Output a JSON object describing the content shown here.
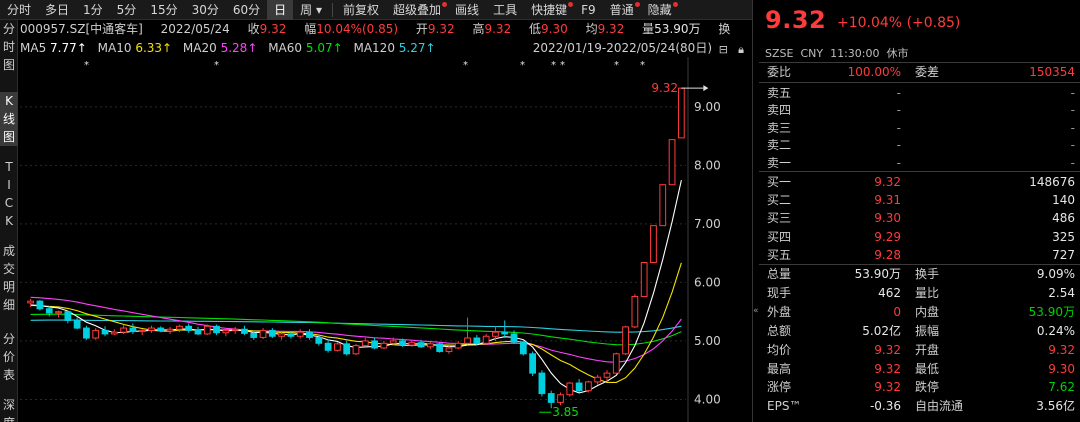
{
  "toolbar": {
    "items": [
      "分时",
      "多日",
      "1分",
      "5分",
      "15分",
      "30分",
      "60分",
      "日",
      "周",
      "前复权",
      "超级叠加",
      "画线",
      "工具",
      "快捷键",
      "F9",
      "普通",
      "隐藏"
    ],
    "active": "日"
  },
  "vtabs": [
    "分时图",
    "K线图",
    "TICK",
    "成交明细",
    "分价表",
    "深度"
  ],
  "info": {
    "code": "000957.SZ[中通客车]",
    "date": "2022/05/24",
    "close_label": "收",
    "close": "9.32",
    "amp_label": "幅",
    "amp": "10.04%(0.85)",
    "open_label": "开",
    "open": "9.32",
    "high_label": "高",
    "high": "9.32",
    "low_label": "低",
    "low": "9.30",
    "avg_label": "均",
    "avg": "9.32",
    "vol_label": "量",
    "vol": "53.90万",
    "turn_label": "换"
  },
  "ma": {
    "ma5_label": "MA5",
    "ma5": "7.77↑",
    "ma10_label": "MA10",
    "ma10": "6.33↑",
    "ma20_label": "MA20",
    "ma20": "5.28↑",
    "ma60_label": "MA60",
    "ma60": "5.07↑",
    "ma120_label": "MA120",
    "ma120": "5.27↑",
    "range": "2022/01/19-2022/05/24(80日)"
  },
  "colors": {
    "up": "#ff3b3b",
    "down": "#00cfe0",
    "ma5": "#ffffff",
    "ma10": "#f2e200",
    "ma20": "#ff40ff",
    "ma60": "#00e000",
    "ma120": "#2ad0e0"
  },
  "chart_data": {
    "type": "candlestick",
    "ylim": [
      3.7,
      9.75
    ],
    "yticks": [
      "9.00",
      "8.00",
      "7.00",
      "6.00",
      "5.00",
      "4.00"
    ],
    "ytick_values": [
      9,
      8,
      7,
      6,
      5,
      4
    ],
    "max_label": "9.32",
    "min_label": "3.85",
    "candles": [
      [
        5.65,
        5.72,
        5.58,
        5.68
      ],
      [
        5.68,
        5.7,
        5.52,
        5.55
      ],
      [
        5.55,
        5.6,
        5.42,
        5.48
      ],
      [
        5.48,
        5.52,
        5.4,
        5.5
      ],
      [
        5.5,
        5.52,
        5.3,
        5.35
      ],
      [
        5.35,
        5.4,
        5.2,
        5.22
      ],
      [
        5.22,
        5.26,
        5.02,
        5.05
      ],
      [
        5.05,
        5.22,
        5.02,
        5.18
      ],
      [
        5.18,
        5.25,
        5.08,
        5.12
      ],
      [
        5.12,
        5.2,
        5.1,
        5.15
      ],
      [
        5.15,
        5.28,
        5.12,
        5.22
      ],
      [
        5.22,
        5.3,
        5.12,
        5.16
      ],
      [
        5.16,
        5.2,
        5.1,
        5.18
      ],
      [
        5.18,
        5.26,
        5.14,
        5.22
      ],
      [
        5.22,
        5.25,
        5.15,
        5.17
      ],
      [
        5.17,
        5.24,
        5.12,
        5.2
      ],
      [
        5.2,
        5.28,
        5.15,
        5.25
      ],
      [
        5.25,
        5.3,
        5.14,
        5.18
      ],
      [
        5.18,
        5.24,
        5.1,
        5.12
      ],
      [
        5.12,
        5.28,
        5.1,
        5.25
      ],
      [
        5.25,
        5.28,
        5.1,
        5.14
      ],
      [
        5.14,
        5.22,
        5.08,
        5.18
      ],
      [
        5.18,
        5.24,
        5.12,
        5.2
      ],
      [
        5.2,
        5.26,
        5.1,
        5.13
      ],
      [
        5.13,
        5.18,
        5.02,
        5.06
      ],
      [
        5.06,
        5.22,
        5.03,
        5.18
      ],
      [
        5.18,
        5.22,
        5.05,
        5.08
      ],
      [
        5.08,
        5.15,
        5.02,
        5.12
      ],
      [
        5.12,
        5.16,
        5.04,
        5.08
      ],
      [
        5.08,
        5.2,
        5.04,
        5.15
      ],
      [
        5.15,
        5.2,
        5.02,
        5.06
      ],
      [
        5.06,
        5.1,
        4.92,
        4.96
      ],
      [
        4.96,
        5.02,
        4.8,
        4.84
      ],
      [
        4.84,
        4.98,
        4.82,
        4.95
      ],
      [
        4.95,
        5.0,
        4.75,
        4.78
      ],
      [
        4.78,
        4.95,
        4.76,
        4.92
      ],
      [
        4.92,
        5.05,
        4.9,
        5.0
      ],
      [
        5.0,
        5.06,
        4.86,
        4.88
      ],
      [
        4.88,
        5.0,
        4.86,
        4.96
      ],
      [
        4.96,
        5.06,
        4.92,
        5.0
      ],
      [
        5.0,
        5.04,
        4.9,
        4.93
      ],
      [
        4.93,
        5.0,
        4.9,
        4.97
      ],
      [
        4.97,
        5.02,
        4.88,
        4.9
      ],
      [
        4.9,
        4.98,
        4.86,
        4.95
      ],
      [
        4.95,
        4.98,
        4.8,
        4.82
      ],
      [
        4.82,
        4.92,
        4.78,
        4.88
      ],
      [
        4.88,
        5.0,
        4.86,
        4.96
      ],
      [
        4.96,
        5.4,
        4.94,
        5.05
      ],
      [
        5.05,
        5.1,
        4.92,
        4.96
      ],
      [
        4.96,
        5.12,
        4.94,
        5.08
      ],
      [
        5.08,
        5.25,
        5.0,
        5.15
      ],
      [
        5.15,
        5.35,
        5.05,
        5.12
      ],
      [
        5.12,
        5.18,
        4.95,
        4.98
      ],
      [
        4.98,
        5.02,
        4.75,
        4.78
      ],
      [
        4.78,
        4.82,
        4.4,
        4.45
      ],
      [
        4.45,
        4.5,
        4.05,
        4.1
      ],
      [
        4.1,
        4.15,
        3.85,
        3.95
      ],
      [
        3.95,
        4.12,
        3.9,
        4.08
      ],
      [
        4.08,
        4.3,
        4.05,
        4.28
      ],
      [
        4.28,
        4.35,
        4.12,
        4.15
      ],
      [
        4.15,
        4.32,
        4.12,
        4.3
      ],
      [
        4.3,
        4.42,
        4.25,
        4.38
      ],
      [
        4.38,
        4.5,
        4.3,
        4.45
      ],
      [
        4.45,
        4.8,
        4.43,
        4.78
      ],
      [
        4.78,
        5.26,
        4.76,
        5.24
      ],
      [
        5.24,
        5.8,
        5.22,
        5.76
      ],
      [
        5.76,
        6.34,
        5.76,
        6.34
      ],
      [
        6.34,
        6.97,
        6.34,
        6.97
      ],
      [
        6.97,
        7.67,
        6.97,
        7.67
      ],
      [
        7.67,
        8.44,
        7.67,
        8.44
      ],
      [
        8.47,
        9.32,
        8.47,
        9.32
      ]
    ]
  },
  "quote": {
    "price": "9.32",
    "change": "+10.04% (+0.85)",
    "market": "SZSE",
    "currency": "CNY",
    "time": "11:30:00",
    "status": "休市",
    "weibi_label": "委比",
    "weibi": "100.00%",
    "weicha_label": "委差",
    "weicha": "150354",
    "asks": [
      {
        "label": "卖五",
        "price": "-",
        "vol": "-"
      },
      {
        "label": "卖四",
        "price": "-",
        "vol": "-"
      },
      {
        "label": "卖三",
        "price": "-",
        "vol": "-"
      },
      {
        "label": "卖二",
        "price": "-",
        "vol": "-"
      },
      {
        "label": "卖一",
        "price": "-",
        "vol": "-"
      }
    ],
    "bids": [
      {
        "label": "买一",
        "price": "9.32",
        "vol": "148676"
      },
      {
        "label": "买二",
        "price": "9.31",
        "vol": "140"
      },
      {
        "label": "买三",
        "price": "9.30",
        "vol": "486"
      },
      {
        "label": "买四",
        "price": "9.29",
        "vol": "325"
      },
      {
        "label": "买五",
        "price": "9.28",
        "vol": "727"
      }
    ],
    "stats": [
      {
        "l1": "总量",
        "v1": "53.90万",
        "c1": "wht",
        "l2": "换手",
        "v2": "9.09%",
        "c2": "wht"
      },
      {
        "l1": "现手",
        "v1": "462",
        "c1": "wht",
        "l2": "量比",
        "v2": "2.54",
        "c2": "wht"
      },
      {
        "l1": "外盘",
        "v1": "0",
        "c1": "red",
        "l2": "内盘",
        "v2": "53.90万",
        "c2": "green"
      },
      {
        "l1": "总额",
        "v1": "5.02亿",
        "c1": "wht",
        "l2": "振幅",
        "v2": "0.24%",
        "c2": "wht"
      },
      {
        "l1": "均价",
        "v1": "9.32",
        "c1": "red",
        "l2": "开盘",
        "v2": "9.32",
        "c2": "red"
      },
      {
        "l1": "最高",
        "v1": "9.32",
        "c1": "red",
        "l2": "最低",
        "v2": "9.30",
        "c2": "red"
      },
      {
        "l1": "涨停",
        "v1": "9.32",
        "c1": "red",
        "l2": "跌停",
        "v2": "7.62",
        "c2": "green"
      },
      {
        "l1": "EPS™",
        "v1": "-0.36",
        "c1": "wht",
        "l2": "自由流通",
        "v2": "3.56亿",
        "c2": "wht"
      }
    ]
  }
}
